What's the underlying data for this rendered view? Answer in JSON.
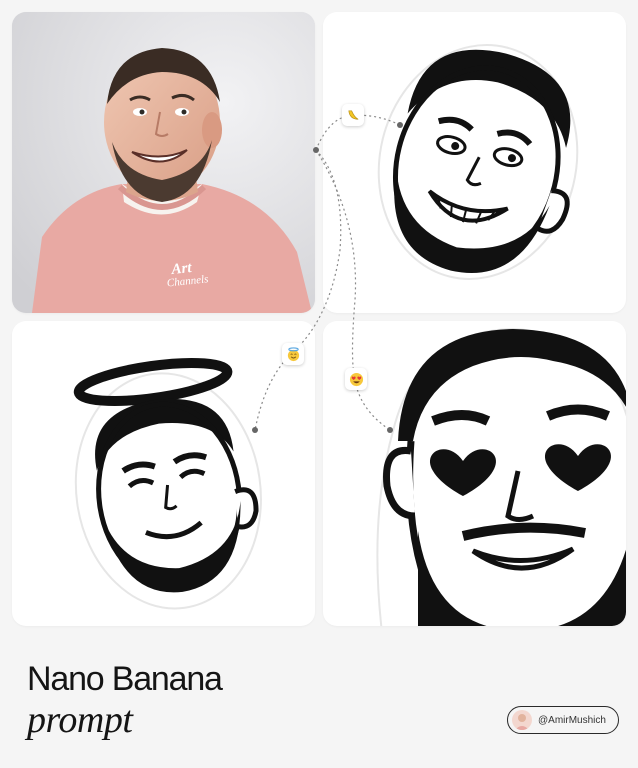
{
  "title": {
    "line1": "Nano Banana",
    "line2": "prompt"
  },
  "author": {
    "handle": "@AmirMushich"
  },
  "photo": {
    "sweater_logo_text": "Art Channels"
  },
  "badges": {
    "banana": "banana-emoji",
    "halo": "smiling-face-with-halo-emoji",
    "love": "heart-eyes-emoji"
  },
  "colors": {
    "background": "#f5f5f5",
    "panel": "#ffffff",
    "sweater": "#e8a9a3",
    "ink": "#111111"
  }
}
